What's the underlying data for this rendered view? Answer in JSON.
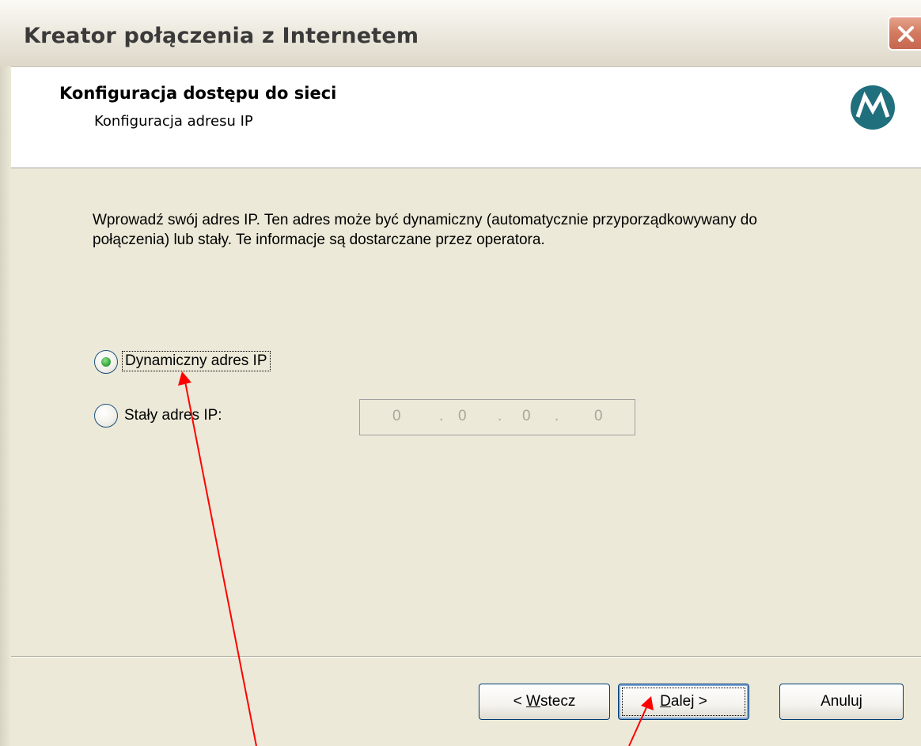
{
  "window": {
    "title": "Kreator połączenia z Internetem"
  },
  "header": {
    "title": "Konfiguracja dostępu do sieci",
    "subtitle": "Konfiguracja adresu IP",
    "logo_icon": "motorola-logo"
  },
  "content": {
    "description": "Wprowadź swój adres IP. Ten adres może być dynamiczny (automatycznie przyporządkowywany do połączenia) lub stały. Te informacje są dostarczane przez operatora.",
    "options": [
      {
        "label": "Dynamiczny adres IP",
        "selected": true
      },
      {
        "label": "Stały adres IP:",
        "selected": false
      }
    ],
    "ip_address": {
      "octets": [
        "0",
        "0",
        "0",
        "0"
      ],
      "enabled": false
    }
  },
  "buttons": {
    "back": {
      "prefix": "< ",
      "mnemonic": "W",
      "rest": "stecz"
    },
    "next": {
      "mnemonic": "D",
      "rest": "alej >"
    },
    "cancel": {
      "label": "Anuluj"
    }
  },
  "colors": {
    "dialog_bg": "#ece9d8",
    "annotation_arrow": "#ff0000",
    "logo": "#1f6f7d"
  }
}
